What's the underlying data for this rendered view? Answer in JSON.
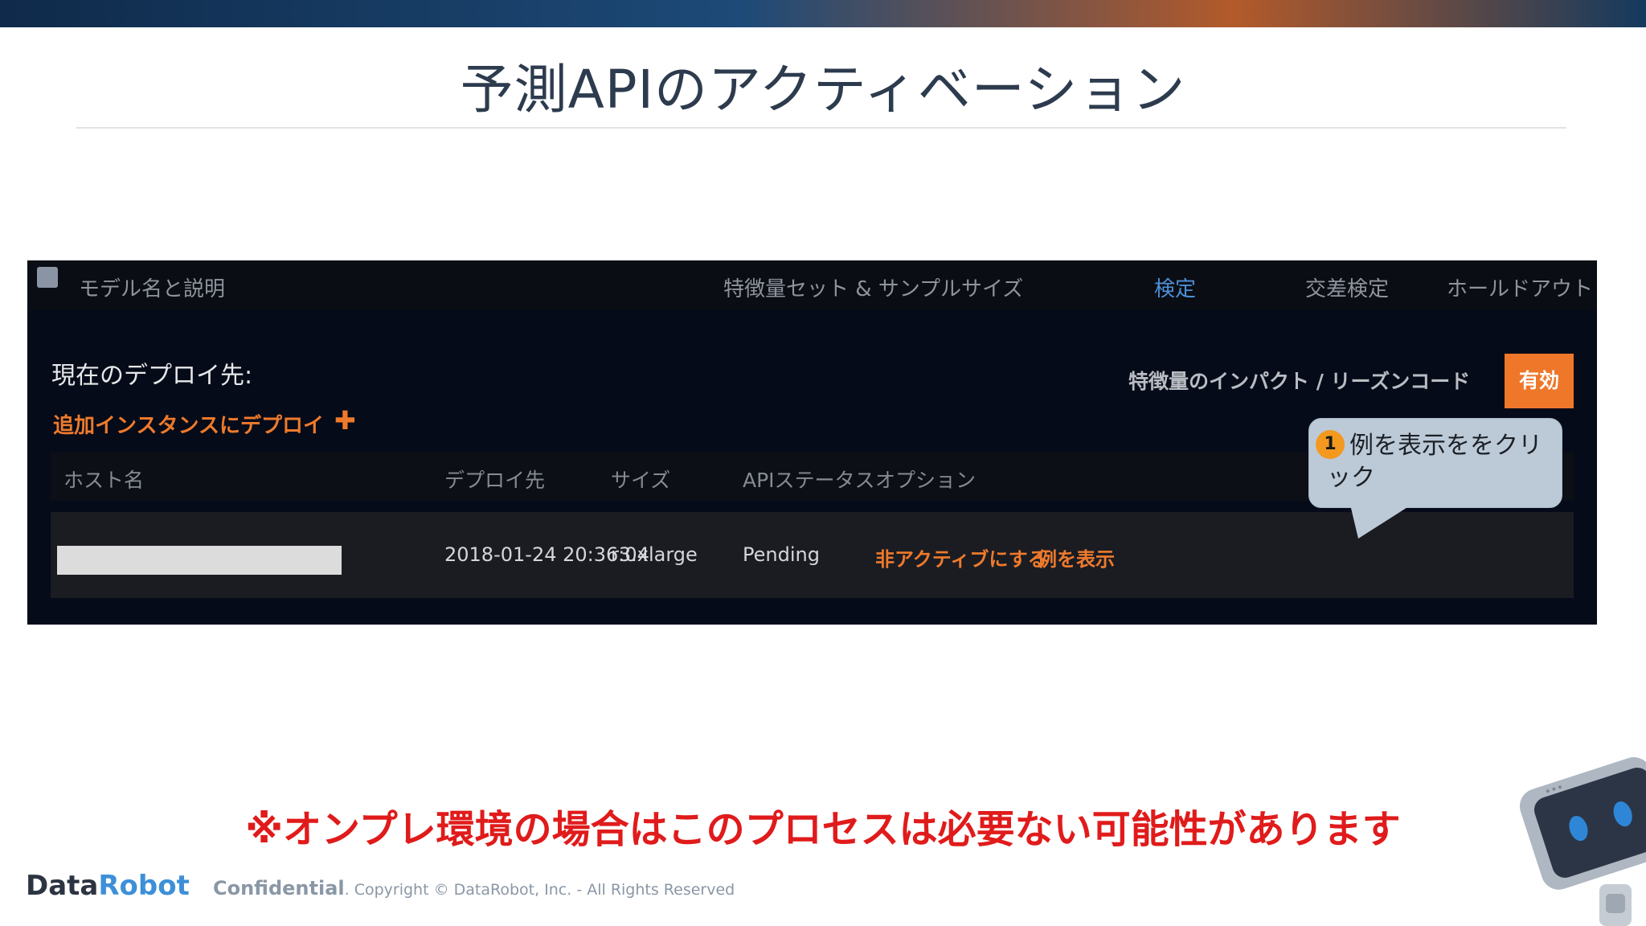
{
  "slide": {
    "title": "予測APIのアクティベーション",
    "warning": "※オンプレ環境の場合はこのプロセスは必要ない可能性があります"
  },
  "app_header": {
    "columns": [
      "モデル名と説明",
      "特徴量セット & サンプルサイズ",
      "検定",
      "交差検定",
      "ホールドアウト"
    ],
    "active_column": "検定"
  },
  "deploy_panel": {
    "current_label": "現在のデプロイ先:",
    "add_instance_link": "追加インスタンスにデプロイ",
    "add_icon": "plus-icon",
    "impact_label": "特徴量のインパクト / リーズンコード",
    "enable_button": "有効",
    "table": {
      "headers": [
        "ホスト名",
        "デプロイ先",
        "サイズ",
        "APIステータス",
        "オプション"
      ],
      "rows": [
        {
          "host": "",
          "deployed_at": "2018-01-24 20:36:04",
          "size": "r3.xlarge",
          "api_status": "Pending",
          "deactivate_label": "非アクティブにする",
          "show_example_label": "例を表示"
        }
      ]
    }
  },
  "callout": {
    "number": "1",
    "text": "例を表示ををクリック"
  },
  "footer": {
    "brand_data": "Data",
    "brand_robot": "Robot",
    "confidential": "Confidential",
    "copyright": ". Copyright © DataRobot, Inc. - All Rights Reserved"
  },
  "colors": {
    "accent_orange": "#ee7a2c",
    "active_blue": "#4d90d6",
    "warning_red": "#e01b1b",
    "brand_blue": "#3d8fd8"
  }
}
